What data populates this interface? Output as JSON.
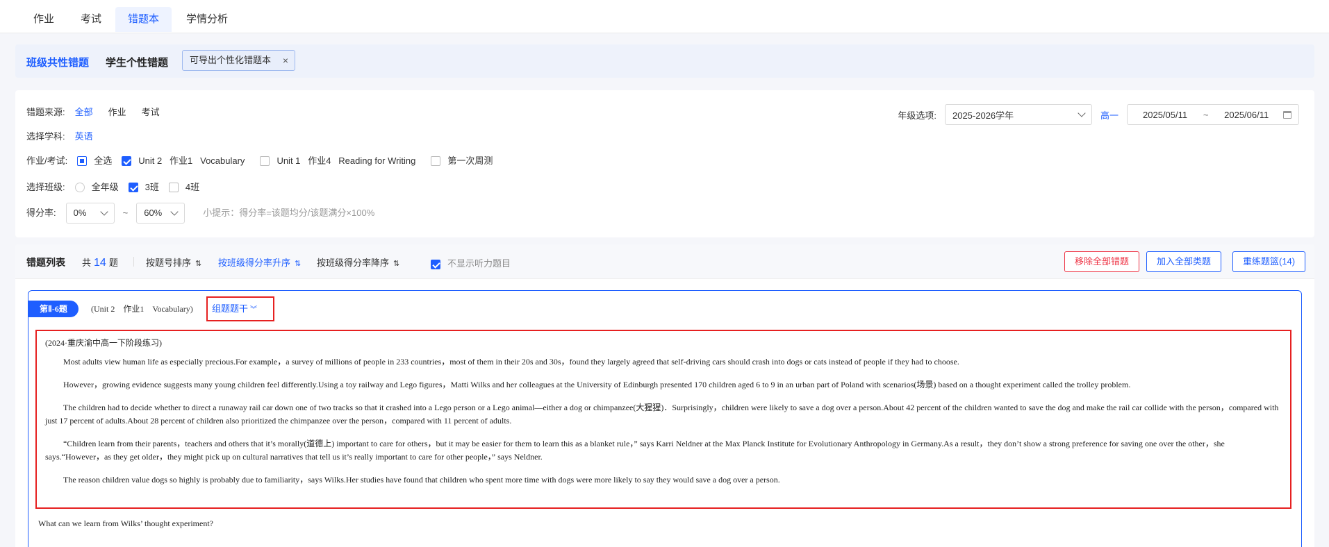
{
  "top_tabs": [
    {
      "label": "作业"
    },
    {
      "label": "考试"
    },
    {
      "label": "错题本"
    },
    {
      "label": "学情分析"
    }
  ],
  "sub_tabs": {
    "class_common": "班级共性错题",
    "student_personal": "学生个性错题",
    "export_tag": "可导出个性化错题本",
    "close_symbol": "×"
  },
  "filters": {
    "source_label": "错题来源:",
    "source_options": [
      "全部",
      "作业",
      "考试"
    ],
    "subject_label": "选择学科:",
    "subject_value": "英语",
    "task_label": "作业/考试:",
    "task_select_all": "全选",
    "task_items": [
      {
        "label": "Unit 2   作业1   Vocabulary"
      },
      {
        "label": "Unit 1   作业4   Reading for Writing"
      },
      {
        "label": "第一次周测"
      }
    ],
    "class_label": "选择班级:",
    "class_options": [
      {
        "label": "全年级"
      },
      {
        "label": "3班"
      },
      {
        "label": "4班"
      }
    ],
    "score_label": "得分率:",
    "score_min": "0%",
    "score_tilde": "~",
    "score_max": "60%",
    "score_hint": "小提示：得分率=该题均分/该题满分×100%",
    "grade_label": "年级选项:",
    "grade_value": "2025-2026学年",
    "grade_level": "高一",
    "date_start": "2025/05/11",
    "date_tilde": "~",
    "date_end": "2025/06/11"
  },
  "list": {
    "title": "错题列表",
    "count_prefix": "共",
    "count": "14",
    "count_suffix": "题",
    "sort_by_number": "按题号排序",
    "sort_asc": "按班级得分率升序",
    "sort_desc": "按班级得分率降序",
    "hide_listening": "不显示听力题目",
    "btn_remove_all": "移除全部错题",
    "btn_add_all": "加入全部类题",
    "btn_retrain": "重练题篮(14)"
  },
  "question": {
    "badge": "第Ⅱ-6题",
    "source": "(Unit 2    作业1    Vocabulary)",
    "group_btn": "组题题干",
    "passage_source": "(2024·重庆渝中高一下阶段练习)",
    "paragraphs": [
      "Most adults view human life as especially precious.For example，a survey of millions of people in 233 countries，most of them in their 20s and 30s，found they largely agreed that self-driving cars should crash into dogs or cats instead of people if they had to choose.",
      "However，growing evidence suggests many young children feel differently.Using a toy railway and Lego figures，Matti Wilks and her colleagues at the University of Edinburgh presented 170 children aged 6 to 9 in an urban part of Poland with scenarios(场景) based on a thought experiment called the trolley problem.",
      "The children had to decide whether to direct a runaway rail car down one of two tracks so that it crashed into a Lego person or a Lego animal—either a dog or chimpanzee(大猩猩)．Surprisingly，children were likely to save a dog over a person.About 42 percent of the children wanted to save the dog and make the rail car collide with the person，compared with just 17 percent of adults.About 28 percent of children also prioritized the chimpanzee over the person，compared with 11 percent of adults.",
      "“Children learn from their parents，teachers and others that it’s morally(道德上) important to care for others，but it may be easier for them to learn this as a blanket rule，” says Karri Neldner at the Max Planck Institute for Evolutionary Anthropology in Germany.As a result，they don’t show a strong preference for saving one over the other，she says.“However，as they get older，they might pick up on cultural narratives that tell us it’s really important to care for other people，” says Neldner.",
      "The reason children value dogs so highly is probably due to familiarity，says Wilks.Her studies have found that children who spent more time with dogs were more likely to say they would save a dog over a person."
    ],
    "prompt": "What can we learn from Wilks’ thought experiment?"
  },
  "colors": {
    "accent": "#1e5eff",
    "danger": "#e62020",
    "panel_bg": "#eef2fb"
  }
}
